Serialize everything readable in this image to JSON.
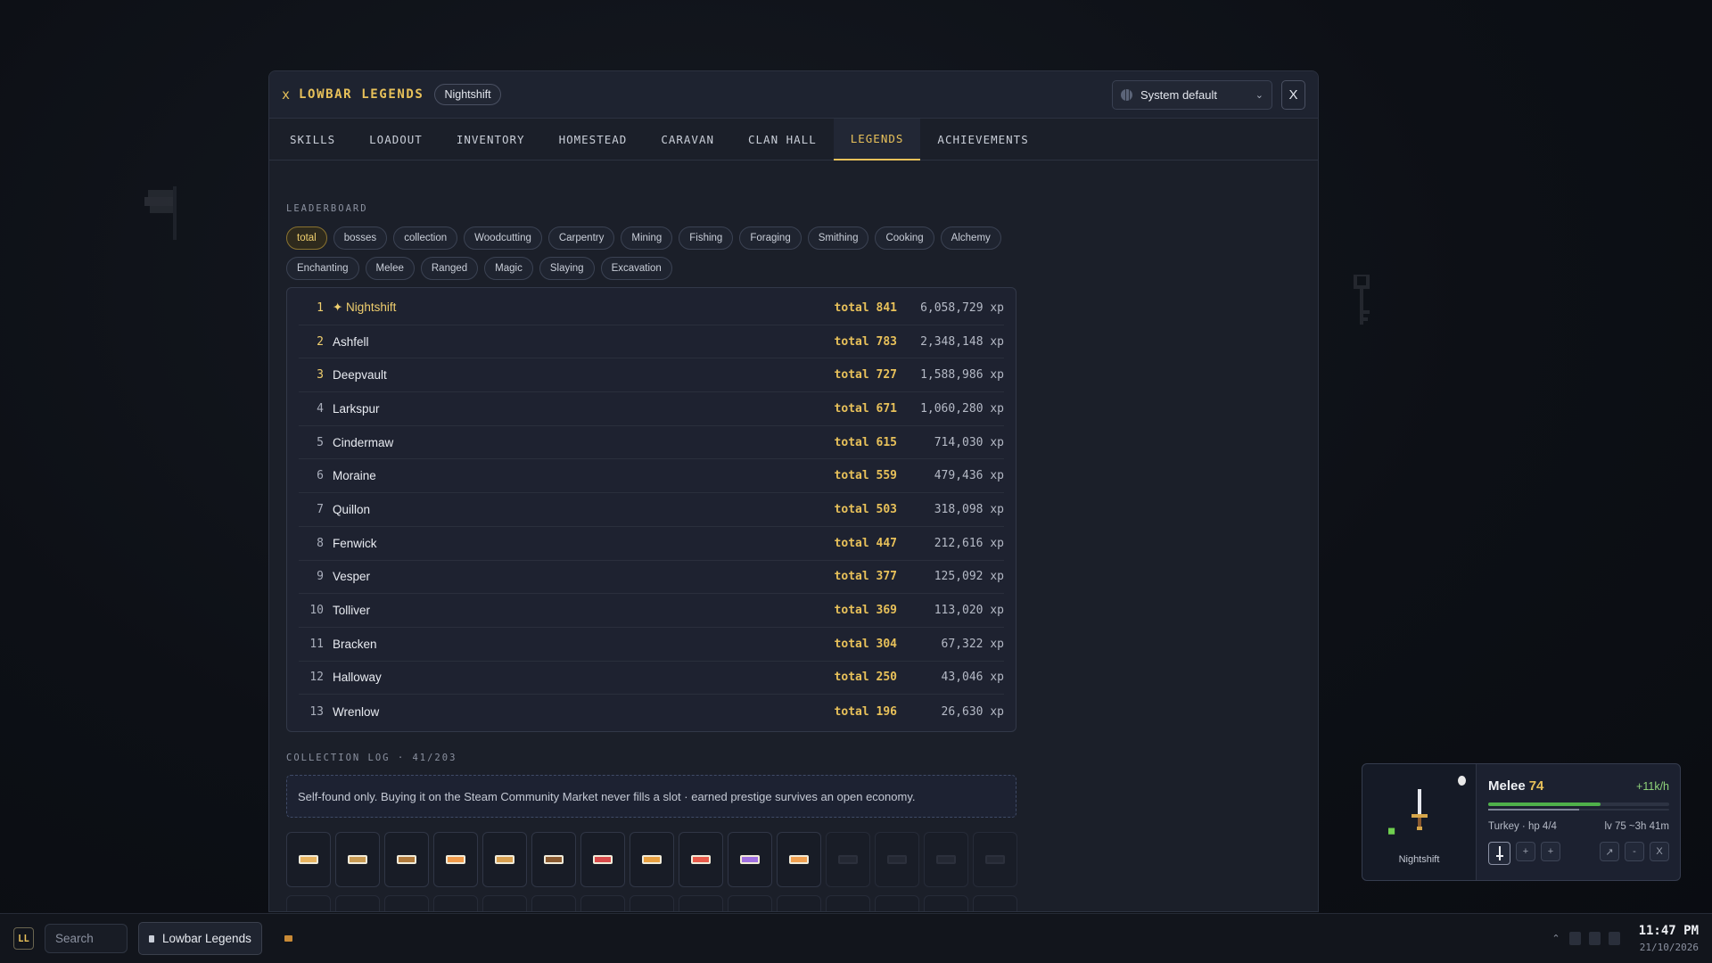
{
  "app": {
    "title_prefix": "x",
    "title": "LOWBAR LEGENDS",
    "character": "Nightshift",
    "language": "System default",
    "close": "X"
  },
  "tabs": [
    "SKILLS",
    "LOADOUT",
    "INVENTORY",
    "HOMESTEAD",
    "CARAVAN",
    "CLAN HALL",
    "LEGENDS",
    "ACHIEVEMENTS"
  ],
  "active_tab": "LEGENDS",
  "leaderboard": {
    "label": "LEADERBOARD",
    "filters": [
      "total",
      "bosses",
      "collection",
      "Woodcutting",
      "Carpentry",
      "Mining",
      "Fishing",
      "Foraging",
      "Smithing",
      "Cooking",
      "Alchemy",
      "Enchanting",
      "Melee",
      "Ranged",
      "Magic",
      "Slaying",
      "Excavation"
    ],
    "active_filter": "total",
    "rows": [
      {
        "rank": "1",
        "name": "✦ Nightshift",
        "total": "total 841",
        "xp": "6,058,729 xp"
      },
      {
        "rank": "2",
        "name": "Ashfell",
        "total": "total 783",
        "xp": "2,348,148 xp"
      },
      {
        "rank": "3",
        "name": "Deepvault",
        "total": "total 727",
        "xp": "1,588,986 xp"
      },
      {
        "rank": "4",
        "name": "Larkspur",
        "total": "total 671",
        "xp": "1,060,280 xp"
      },
      {
        "rank": "5",
        "name": "Cindermaw",
        "total": "total 615",
        "xp": "714,030 xp"
      },
      {
        "rank": "6",
        "name": "Moraine",
        "total": "total 559",
        "xp": "479,436 xp"
      },
      {
        "rank": "7",
        "name": "Quillon",
        "total": "total 503",
        "xp": "318,098 xp"
      },
      {
        "rank": "8",
        "name": "Fenwick",
        "total": "total 447",
        "xp": "212,616 xp"
      },
      {
        "rank": "9",
        "name": "Vesper",
        "total": "total 377",
        "xp": "125,092 xp"
      },
      {
        "rank": "10",
        "name": "Tolliver",
        "total": "total 369",
        "xp": "113,020 xp"
      },
      {
        "rank": "11",
        "name": "Bracken",
        "total": "total 304",
        "xp": "67,322 xp"
      },
      {
        "rank": "12",
        "name": "Halloway",
        "total": "total 250",
        "xp": "43,046 xp"
      },
      {
        "rank": "13",
        "name": "Wrenlow",
        "total": "total 196",
        "xp": "26,630 xp"
      }
    ]
  },
  "collection": {
    "label": "COLLECTION LOG · 41/203",
    "notice": "Self-found only. Buying it on the Steam Community Market never fills a slot · earned prestige survives an open economy.",
    "slot_colors": [
      "#e8b460",
      "#c89a52",
      "#b07a3c",
      "#f09a4a",
      "#d8a050",
      "#8a5a30",
      "#d84a4a",
      "#e8a040",
      "#e85a4a",
      "#a070e0",
      "#f0a050",
      null,
      null,
      null,
      null
    ]
  },
  "hud": {
    "skill": "Melee",
    "level": "74",
    "rate": "+11k/h",
    "progress": 0.62,
    "portrait_name": "Nightshift",
    "target": "Turkey · hp 4/4",
    "eta": "lv 75 ~3h 41m",
    "buttons": [
      "+",
      "+",
      "↗",
      "-",
      "X"
    ]
  },
  "taskbar": {
    "start": "LL",
    "search": "Search",
    "app": "Lowbar Legends",
    "time": "11:47 PM",
    "date": "21/10/2026"
  }
}
